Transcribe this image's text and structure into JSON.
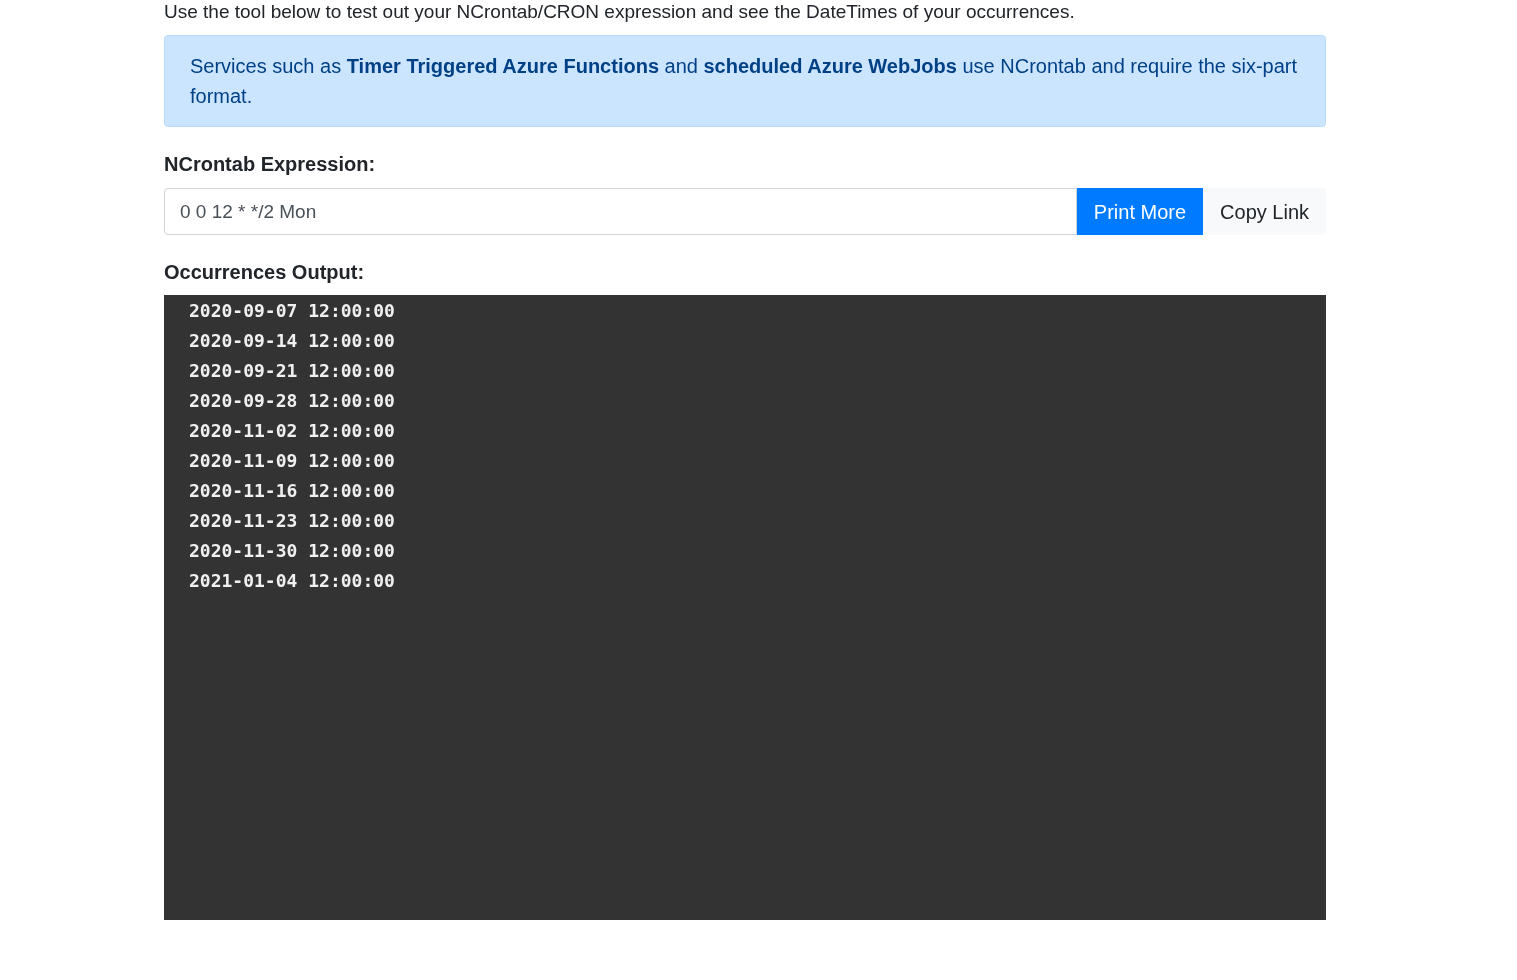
{
  "intro": "Use the tool below to test out your NCrontab/CRON expression and see the DateTimes of your occurrences.",
  "alert": "Services such as **Timer Triggered Azure Functions** and **scheduled Azure WebJobs** use NCrontab and require the six-part format.",
  "expression": {
    "label": "NCrontab Expression:",
    "value": "0 0 12 * */2 Mon",
    "buttons": [
      {
        "label": "Print More",
        "kind": "primary"
      },
      {
        "label": "Copy Link",
        "kind": "light"
      }
    ]
  },
  "output": {
    "label": "Occurrences Output:",
    "lines": [
      "2020-09-07 12:00:00",
      "2020-09-14 12:00:00",
      "2020-09-21 12:00:00",
      "2020-09-28 12:00:00",
      "2020-11-02 12:00:00",
      "2020-11-09 12:00:00",
      "2020-11-16 12:00:00",
      "2020-11-23 12:00:00",
      "2020-11-30 12:00:00",
      "2021-01-04 12:00:00"
    ]
  }
}
